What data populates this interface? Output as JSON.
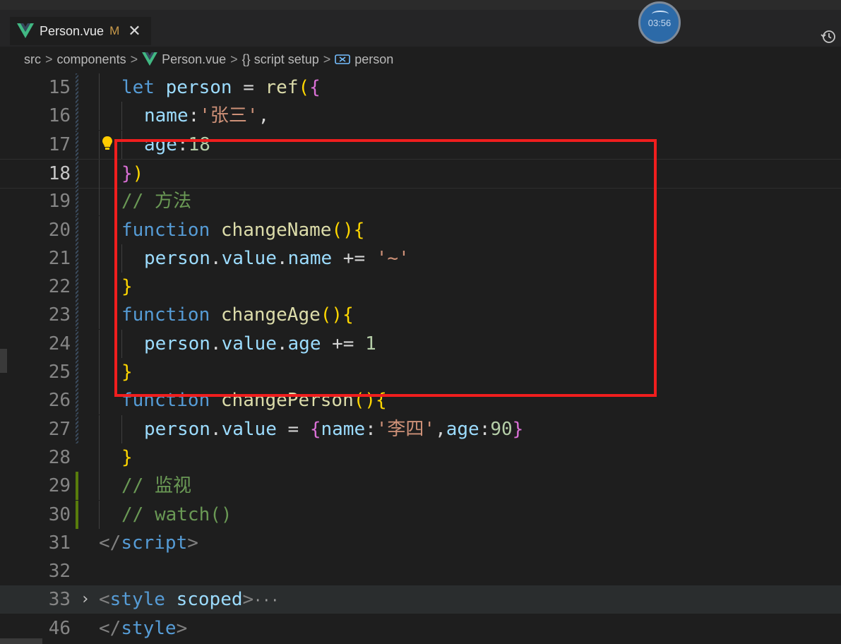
{
  "tab": {
    "filename": "Person.vue",
    "modified_flag": "M",
    "close_glyph": "✕"
  },
  "timer": {
    "time": "03:56"
  },
  "breadcrumb": {
    "items": [
      "src",
      "components",
      "Person.vue",
      "{} script setup",
      "person"
    ],
    "separator": ">"
  },
  "editor": {
    "lines": [
      {
        "num": "15",
        "tokens": [
          [
            "k",
            "let"
          ],
          [
            "t",
            " "
          ],
          [
            "v",
            "person"
          ],
          [
            "t",
            " = "
          ],
          [
            "f",
            "ref"
          ],
          [
            "b1",
            "("
          ],
          [
            "b2",
            "{"
          ]
        ]
      },
      {
        "num": "16",
        "tokens": [
          [
            "v",
            "name"
          ],
          [
            "t",
            ":"
          ],
          [
            "s",
            "'张三'"
          ],
          [
            "t",
            ","
          ]
        ]
      },
      {
        "num": "17",
        "tokens": [
          [
            "v",
            "age"
          ],
          [
            "t",
            ":"
          ],
          [
            "n",
            "18"
          ]
        ]
      },
      {
        "num": "18",
        "tokens": [
          [
            "b2",
            "}"
          ],
          [
            "b1",
            ")"
          ]
        ]
      },
      {
        "num": "19",
        "tokens": [
          [
            "c",
            "// 方法"
          ]
        ]
      },
      {
        "num": "20",
        "tokens": [
          [
            "k",
            "function"
          ],
          [
            "t",
            " "
          ],
          [
            "f",
            "changeName"
          ],
          [
            "b1",
            "()"
          ],
          [
            "b1",
            "{"
          ]
        ]
      },
      {
        "num": "21",
        "tokens": [
          [
            "v",
            "person"
          ],
          [
            "t",
            "."
          ],
          [
            "v",
            "value"
          ],
          [
            "t",
            "."
          ],
          [
            "v",
            "name"
          ],
          [
            "t",
            " += "
          ],
          [
            "s",
            "'~'"
          ]
        ]
      },
      {
        "num": "22",
        "tokens": [
          [
            "b1",
            "}"
          ]
        ]
      },
      {
        "num": "23",
        "tokens": [
          [
            "k",
            "function"
          ],
          [
            "t",
            " "
          ],
          [
            "f",
            "changeAge"
          ],
          [
            "b1",
            "()"
          ],
          [
            "b1",
            "{"
          ]
        ]
      },
      {
        "num": "24",
        "tokens": [
          [
            "v",
            "person"
          ],
          [
            "t",
            "."
          ],
          [
            "v",
            "value"
          ],
          [
            "t",
            "."
          ],
          [
            "v",
            "age"
          ],
          [
            "t",
            " += "
          ],
          [
            "n",
            "1"
          ]
        ]
      },
      {
        "num": "25",
        "tokens": [
          [
            "b1",
            "}"
          ]
        ]
      },
      {
        "num": "26",
        "tokens": [
          [
            "k",
            "function"
          ],
          [
            "t",
            " "
          ],
          [
            "f",
            "changePerson"
          ],
          [
            "b1",
            "()"
          ],
          [
            "b1",
            "{"
          ]
        ]
      },
      {
        "num": "27",
        "tokens": [
          [
            "v",
            "person"
          ],
          [
            "t",
            "."
          ],
          [
            "v",
            "value"
          ],
          [
            "t",
            " = "
          ],
          [
            "b2",
            "{"
          ],
          [
            "v",
            "name"
          ],
          [
            "t",
            ":"
          ],
          [
            "s",
            "'李四'"
          ],
          [
            "t",
            ","
          ],
          [
            "v",
            "age"
          ],
          [
            "t",
            ":"
          ],
          [
            "n",
            "90"
          ],
          [
            "b2",
            "}"
          ]
        ]
      },
      {
        "num": "28",
        "tokens": [
          [
            "b1",
            "}"
          ]
        ]
      },
      {
        "num": "29",
        "tokens": [
          [
            "c",
            "// 监视"
          ]
        ]
      },
      {
        "num": "30",
        "tokens": [
          [
            "c",
            "// watch()"
          ]
        ]
      },
      {
        "num": "31",
        "tokens": [
          [
            "tag",
            "</"
          ],
          [
            "tagname",
            "script"
          ],
          [
            "tag",
            ">"
          ]
        ]
      },
      {
        "num": "32",
        "tokens": []
      },
      {
        "num": "33",
        "tokens": [
          [
            "tag",
            "<"
          ],
          [
            "tagname",
            "style"
          ],
          [
            "t",
            " "
          ],
          [
            "attr",
            "scoped"
          ],
          [
            "tag",
            ">"
          ],
          [
            "ell",
            "···"
          ]
        ]
      },
      {
        "num": "46",
        "tokens": [
          [
            "tag",
            "</"
          ],
          [
            "tagname",
            "style"
          ],
          [
            "tag",
            ">"
          ]
        ]
      }
    ]
  },
  "colors": {
    "accent_box": "#f01e1e",
    "keyword": "#569cd6",
    "function": "#dcdcaa",
    "string": "#ce9178",
    "comment": "#6a9955"
  }
}
